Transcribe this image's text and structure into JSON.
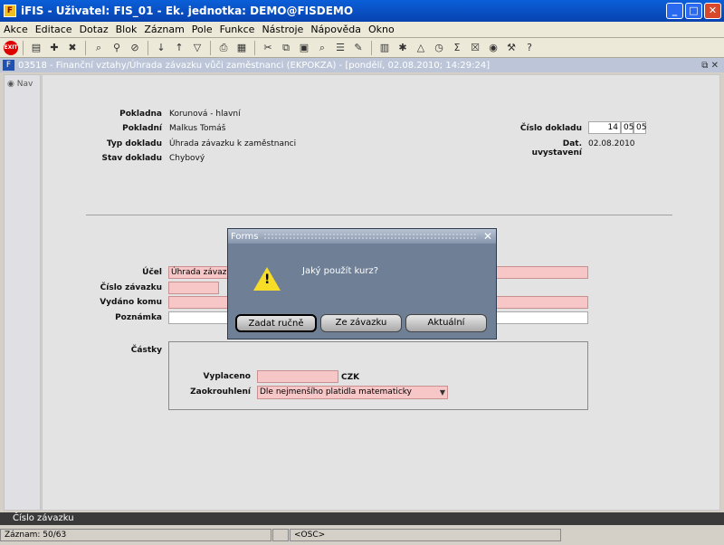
{
  "window": {
    "title": "iFIS - Uživatel: FIS_01 - Ek. jednotka: DEMO@FISDEMO"
  },
  "menu": [
    "Akce",
    "Editace",
    "Dotaz",
    "Blok",
    "Záznam",
    "Pole",
    "Funkce",
    "Nástroje",
    "Nápověda",
    "Okno"
  ],
  "toolbar": {
    "exit_label": "EXIT"
  },
  "form": {
    "title": "03518 - Finanční vztahy/Úhrada závazku vůči zaměstnanci (EKPOKZA) - [pondělí, 02.08.2010; 14:29:24]",
    "nav_label": "Nav",
    "pokladna_label": "Pokladna",
    "pokladna_value": "Korunová - hlavní",
    "pokladni_label": "Pokladní",
    "pokladni_value": "Malkus Tomáš",
    "typ_label": "Typ dokladu",
    "typ_value": "Úhrada závazku k zaměstnanci",
    "stav_label": "Stav dokladu",
    "stav_value": "Chybový",
    "cislo_dokladu_label": "Číslo dokladu",
    "cislo_dokladu_parts": [
      "14",
      "05",
      "05"
    ],
    "dat_vystaveni_label": "Dat. uvystavení",
    "dat_vystaveni_value": "02.08.2010",
    "ucel_label": "Účel",
    "ucel_value": "Úhrada závazku",
    "cislo_zavazku_label": "Číslo závazku",
    "cislo_zavazku_value": "",
    "vydano_label": "Vydáno komu",
    "vydano_value": "",
    "poznamka_label": "Poznámka",
    "poznamka_value": "",
    "castky_label": "Částky",
    "vyplaceno_label": "Vyplaceno",
    "vyplaceno_value": "",
    "currency": "CZK",
    "zaokrouhleni_label": "Zaokrouhlení",
    "zaokrouhleni_value": "Dle nejmenšího platidla matematicky"
  },
  "status": {
    "field_hint": "Číslo závazku",
    "record": "Záznam: 50/63",
    "osc": "<OSC>"
  },
  "dialog": {
    "title": "Forms",
    "message": "Jaký použít kurz?",
    "btn_manual": "Zadat ručně",
    "btn_from": "Ze závazku",
    "btn_current": "Aktuální",
    "close": "✕"
  },
  "colors": {
    "required_field": "#f7c6c6",
    "dialog_bg": "#6e7f96"
  }
}
